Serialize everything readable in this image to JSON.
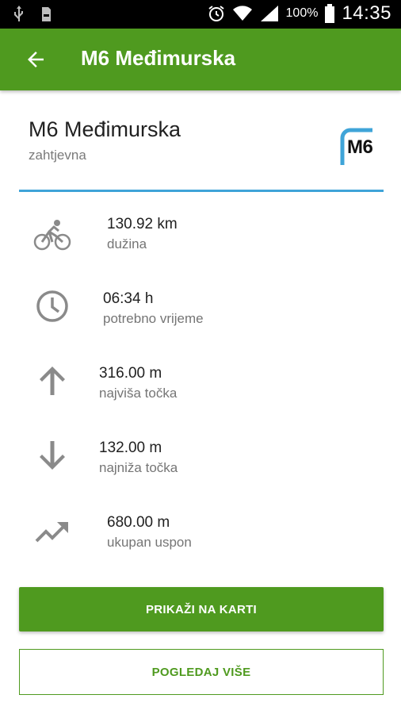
{
  "status_bar": {
    "battery_percent": "100%",
    "time": "14:35"
  },
  "app_bar": {
    "title": "M6 Međimurska",
    "back_icon": "arrow-back-icon"
  },
  "route": {
    "name": "M6 Međimurska",
    "difficulty": "zahtjevna",
    "logo_text": "M6",
    "accent_color": "#3fa4d8"
  },
  "stats": [
    {
      "icon": "bicycle-icon",
      "value": "130.92 km",
      "label": "dužina"
    },
    {
      "icon": "clock-icon",
      "value": "06:34 h",
      "label": "potrebno vrijeme"
    },
    {
      "icon": "arrow-up-icon",
      "value": "316.00 m",
      "label": "najviša točka"
    },
    {
      "icon": "arrow-down-icon",
      "value": "132.00 m",
      "label": "najniža točka"
    },
    {
      "icon": "trending-up-icon",
      "value": "680.00 m",
      "label": "ukupan uspon"
    }
  ],
  "buttons": {
    "show_on_map": "PRIKAŽI NA KARTI",
    "see_more": "POGLEDAJ VIŠE"
  },
  "colors": {
    "primary": "#4f9a1f",
    "icon_gray": "#8a8a8a"
  }
}
